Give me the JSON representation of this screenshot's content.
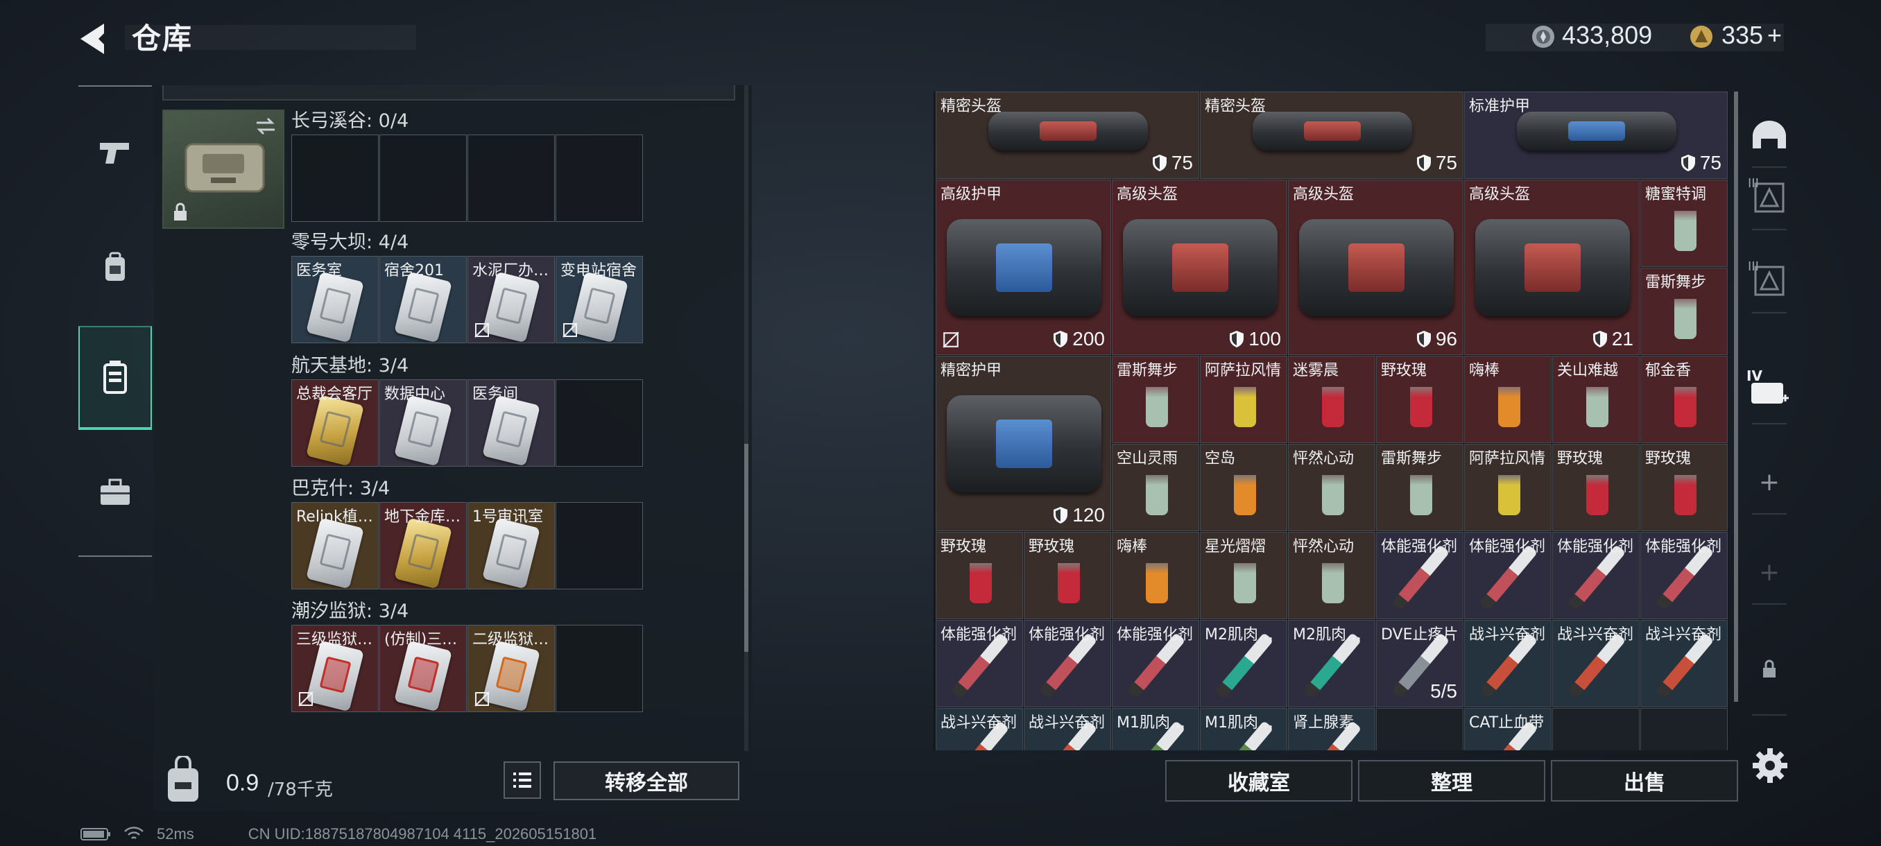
{
  "header": {
    "title": "仓库",
    "currency_1": "433,809",
    "currency_2": "335",
    "currency_2_plus": "+"
  },
  "left_nav": [
    {
      "icon": "gun-icon"
    },
    {
      "icon": "backpack-icon"
    },
    {
      "icon": "keychain-icon",
      "active": true
    },
    {
      "icon": "briefcase-icon"
    }
  ],
  "keychain": {
    "sections": [
      {
        "title": "长弓溪谷: 0/4",
        "slots": []
      },
      {
        "title": "零号大坝: 4/4",
        "slots": [
          {
            "label": "医务室",
            "color": "blue"
          },
          {
            "label": "宿舍201",
            "color": "blue"
          },
          {
            "label": "水泥厂办…",
            "color": "purple",
            "nobind": true
          },
          {
            "label": "变电站宿舍",
            "color": "blue",
            "nobind": true
          }
        ]
      },
      {
        "title": "航天基地: 3/4",
        "slots": [
          {
            "label": "总裁会客厅",
            "color": "red",
            "card": "gold"
          },
          {
            "label": "数据中心",
            "color": "purple"
          },
          {
            "label": "医务间",
            "color": "purple"
          }
        ]
      },
      {
        "title": "巴克什: 3/4",
        "slots": [
          {
            "label": "Relink植…",
            "color": "gold"
          },
          {
            "label": "地下金库…",
            "color": "red",
            "card": "gold"
          },
          {
            "label": "1号审讯室",
            "color": "gold"
          }
        ]
      },
      {
        "title": "潮汐监狱: 3/4",
        "slots": [
          {
            "label": "三级监狱…",
            "color": "red",
            "card": "red",
            "nobind": true
          },
          {
            "label": "(仿制)三…",
            "color": "red",
            "card": "red"
          },
          {
            "label": "二级监狱…",
            "color": "gold",
            "card": "orange",
            "nobind": true
          }
        ]
      }
    ]
  },
  "weight": {
    "current": "0.9",
    "max": "/78千克"
  },
  "buttons": {
    "transfer_all": "转移全部",
    "collection": "收藏室",
    "organize": "整理",
    "sell": "出售"
  },
  "items": {
    "r0": [
      {
        "label": "精密头盔",
        "value": "75",
        "color": "brown"
      },
      {
        "label": "精密头盔",
        "value": "75",
        "color": "brown"
      },
      {
        "label": "标准护甲",
        "value": "75",
        "color": "purple"
      }
    ],
    "r1": [
      {
        "label": "高级护甲",
        "value": "200",
        "color": "red",
        "nobind": true
      },
      {
        "label": "高级头盔",
        "value": "100",
        "color": "red"
      },
      {
        "label": "高级头盔",
        "value": "96",
        "color": "red"
      },
      {
        "label": "高级头盔",
        "value": "21",
        "color": "red"
      }
    ],
    "r1_side": [
      {
        "label": "糖蜜特调",
        "color": "red"
      },
      {
        "label": "雷斯舞步",
        "color": "red"
      }
    ],
    "r2_big": {
      "label": "精密护甲",
      "value": "120",
      "color": "brown"
    },
    "r2": [
      {
        "label": "雷斯舞步",
        "color": "red"
      },
      {
        "label": "阿萨拉风情",
        "color": "red"
      },
      {
        "label": "迷雾晨",
        "color": "red"
      },
      {
        "label": "野玫瑰",
        "color": "red"
      },
      {
        "label": "嗨棒",
        "color": "red"
      },
      {
        "label": "关山难越",
        "color": "red"
      },
      {
        "label": "郁金香",
        "color": "red"
      }
    ],
    "r3": [
      {
        "label": "空山灵雨",
        "color": "brown"
      },
      {
        "label": "空岛",
        "color": "brown"
      },
      {
        "label": "怦然心动",
        "color": "brown"
      },
      {
        "label": "雷斯舞步",
        "color": "brown"
      },
      {
        "label": "阿萨拉风情",
        "color": "brown"
      },
      {
        "label": "野玫瑰",
        "color": "brown"
      },
      {
        "label": "野玫瑰",
        "color": "brown"
      }
    ],
    "r4": [
      {
        "label": "野玫瑰",
        "color": "brown"
      },
      {
        "label": "野玫瑰",
        "color": "brown"
      },
      {
        "label": "嗨棒",
        "color": "brown"
      },
      {
        "label": "星光熠熠",
        "color": "brown"
      },
      {
        "label": "怦然心动",
        "color": "brown"
      },
      {
        "label": "体能强化剂",
        "color": "purple"
      },
      {
        "label": "体能强化剂",
        "color": "purple"
      },
      {
        "label": "体能强化剂",
        "color": "purple"
      },
      {
        "label": "体能强化剂",
        "color": "purple"
      }
    ],
    "r5": [
      {
        "label": "体能强化剂",
        "color": "purple"
      },
      {
        "label": "体能强化剂",
        "color": "purple"
      },
      {
        "label": "体能强化剂",
        "color": "purple"
      },
      {
        "label": "M2肌肉…",
        "color": "purple"
      },
      {
        "label": "M2肌肉…",
        "color": "purple"
      },
      {
        "label": "DVE止疼片",
        "color": "purple",
        "value": "5/5"
      },
      {
        "label": "战斗兴奋剂",
        "color": "blue"
      },
      {
        "label": "战斗兴奋剂",
        "color": "blue"
      },
      {
        "label": "战斗兴奋剂",
        "color": "blue"
      }
    ],
    "r6": [
      {
        "label": "战斗兴奋剂",
        "color": "blue"
      },
      {
        "label": "战斗兴奋剂",
        "color": "blue"
      },
      {
        "label": "M1肌肉…",
        "color": "blue"
      },
      {
        "label": "M1肌肉…",
        "color": "blue"
      },
      {
        "label": "肾上腺素",
        "color": "blue"
      },
      {
        "label": "",
        "color": "dark"
      },
      {
        "label": "CAT止血带",
        "color": "blue"
      },
      {
        "label": "",
        "color": "dark"
      },
      {
        "label": "",
        "color": "dark"
      }
    ]
  },
  "right_nav": {
    "badge_iii_1": "III",
    "badge_iii_2": "III",
    "badge_iv": "IV",
    "add": "+",
    "add2": "+"
  },
  "status": {
    "ping": "52ms",
    "uid": "CN UID:18875187804987104 4115_202605151801"
  },
  "colors": {
    "accent": "#4ad6b0",
    "cell_brown": "#3a2e2a",
    "cell_red": "#4c2428",
    "cell_purple": "#2e2d3f",
    "cell_blue": "#25333e"
  }
}
